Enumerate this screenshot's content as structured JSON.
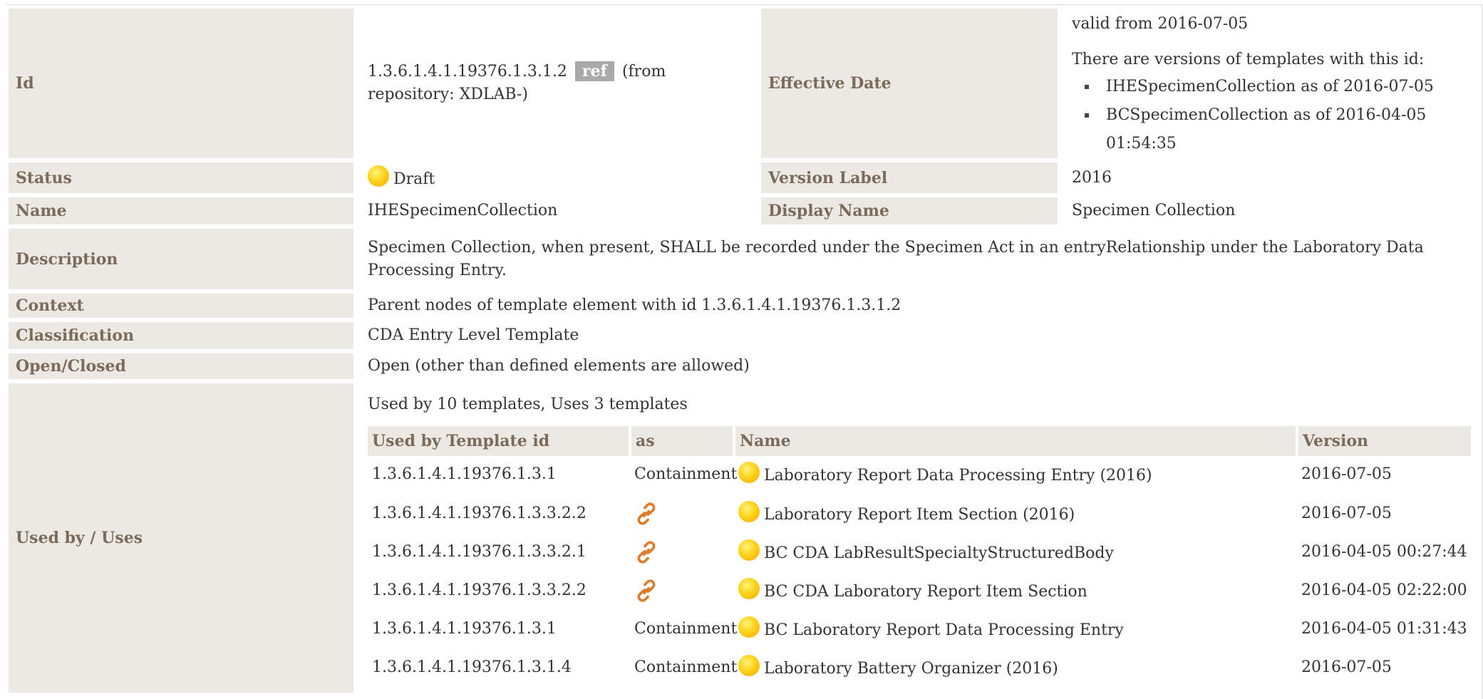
{
  "id": {
    "label": "Id",
    "value": "1.3.6.1.4.1.19376.1.3.1.2",
    "ref_badge": "ref",
    "repository": "(from repository: XDLAB-)"
  },
  "effective_date": {
    "label": "Effective Date",
    "valid_from": "valid from 2016-07-05",
    "versions_intro": "There are versions of templates with this id:",
    "versions": [
      "IHESpecimenCollection as of 2016-07-05",
      "BCSpecimenCollection as of 2016-04-05 01:54:35"
    ]
  },
  "status": {
    "label": "Status",
    "value": "Draft",
    "icon": "draft-status-dot",
    "color": "#ffd21a"
  },
  "version_label": {
    "label": "Version Label",
    "value": "2016"
  },
  "name": {
    "label": "Name",
    "value": "IHESpecimenCollection"
  },
  "display_name": {
    "label": "Display Name",
    "value": "Specimen Collection"
  },
  "description": {
    "label": "Description",
    "value": "Specimen Collection, when present, SHALL be recorded under the Specimen Act in an entryRelationship under the Laboratory Data Processing Entry."
  },
  "context": {
    "label": "Context",
    "value": "Parent nodes of template element with id 1.3.6.1.4.1.19376.1.3.1.2"
  },
  "classification": {
    "label": "Classification",
    "value": "CDA Entry Level Template"
  },
  "open_closed": {
    "label": "Open/Closed",
    "value": "Open (other than defined elements are allowed)"
  },
  "used_by": {
    "label": "Used by / Uses",
    "caption": "Used by 10 templates, Uses 3 templates",
    "headers": {
      "template_id": "Used by Template id",
      "as": "as",
      "name": "Name",
      "version": "Version"
    },
    "rows": [
      {
        "template_id": "1.3.6.1.4.1.19376.1.3.1",
        "as": "Containment",
        "as_icon": "",
        "name": "Laboratory Report Data Processing Entry (2016)",
        "version": "2016-07-05"
      },
      {
        "template_id": "1.3.6.1.4.1.19376.1.3.3.2.2",
        "as": "",
        "as_icon": "link-icon",
        "name": "Laboratory Report Item Section (2016)",
        "version": "2016-07-05"
      },
      {
        "template_id": "1.3.6.1.4.1.19376.1.3.3.2.1",
        "as": "",
        "as_icon": "link-icon",
        "name": "BC CDA LabResultSpecialtyStructuredBody",
        "version": "2016-04-05 00:27:44"
      },
      {
        "template_id": "1.3.6.1.4.1.19376.1.3.3.2.2",
        "as": "",
        "as_icon": "link-icon",
        "name": "BC CDA Laboratory Report Item Section",
        "version": "2016-04-05 02:22:00"
      },
      {
        "template_id": "1.3.6.1.4.1.19376.1.3.1",
        "as": "Containment",
        "as_icon": "",
        "name": "BC Laboratory Report Data Processing Entry",
        "version": "2016-04-05 01:31:43"
      },
      {
        "template_id": "1.3.6.1.4.1.19376.1.3.1.4",
        "as": "Containment",
        "as_icon": "",
        "name": "Laboratory Battery Organizer (2016)",
        "version": "2016-07-05"
      }
    ]
  },
  "colors": {
    "label_bg": "#ece9e5",
    "label_text": "#7b6b5a",
    "badge_bg": "#a9a9a9",
    "link_icon": "#e07b2a"
  }
}
